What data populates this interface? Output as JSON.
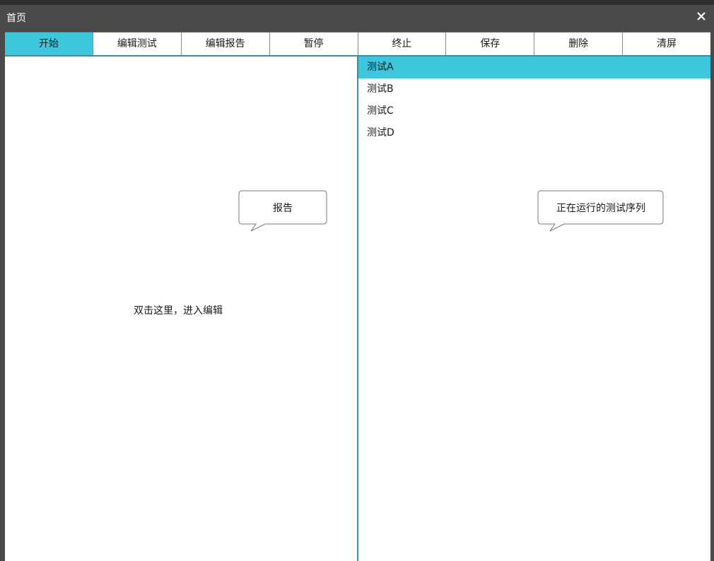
{
  "window": {
    "title": "首页",
    "close_icon": "close-icon"
  },
  "toolbar": {
    "buttons": [
      {
        "label": "开始",
        "active": true
      },
      {
        "label": "编辑测试",
        "active": false
      },
      {
        "label": "编辑报告",
        "active": false
      },
      {
        "label": "暂停",
        "active": false
      },
      {
        "label": "终止",
        "active": false
      },
      {
        "label": "保存",
        "active": false
      },
      {
        "label": "删除",
        "active": false
      },
      {
        "label": "清屏",
        "active": false
      }
    ]
  },
  "report_pane": {
    "callout": "报告",
    "hint": "双击这里，进入编辑"
  },
  "sequence_pane": {
    "callout": "正在运行的测试序列",
    "items": [
      {
        "label": "测试A",
        "selected": true
      },
      {
        "label": "测试B",
        "selected": false
      },
      {
        "label": "测试C",
        "selected": false
      },
      {
        "label": "测试D",
        "selected": false
      }
    ]
  },
  "colors": {
    "accent": "#3ec6dc",
    "frame": "#4a4a4a",
    "divider": "#3a8fa6"
  }
}
